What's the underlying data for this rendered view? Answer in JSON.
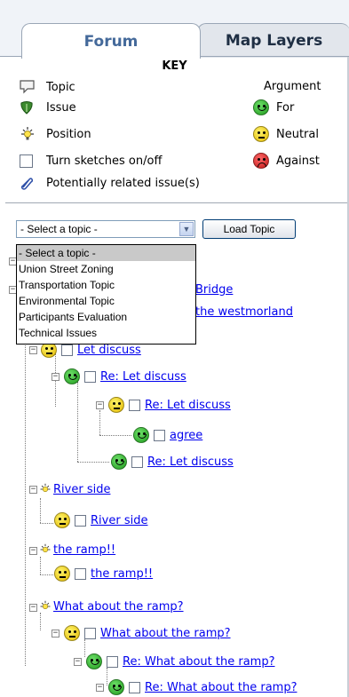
{
  "tabs": [
    {
      "label": "Forum",
      "active": true
    },
    {
      "label": "Map Layers",
      "active": false
    }
  ],
  "key": {
    "title": "KEY",
    "argument_title": "Argument",
    "items": [
      {
        "label": "Topic",
        "icon": "speech-bubble-icon"
      },
      {
        "label": "Issue",
        "icon": "issue-leaf-icon"
      },
      {
        "label": "Position",
        "icon": "lightbulb-icon"
      },
      {
        "label": "Turn sketches on/off",
        "icon": "checkbox"
      },
      {
        "label": "Potentially related issue(s)",
        "icon": "paperclip-icon"
      }
    ],
    "arguments": [
      {
        "label": "For",
        "icon": "green-smiley-icon",
        "color": "#2aa827"
      },
      {
        "label": "Neutral",
        "icon": "yellow-neutral-icon",
        "color": "#f2d000"
      },
      {
        "label": "Against",
        "icon": "red-frown-icon",
        "color": "#d21d1d"
      }
    ]
  },
  "topic_select": {
    "selected": "- Select a topic -",
    "options": [
      "- Select a topic -",
      "Union Street Zoning",
      "Transportation Topic",
      "Environmental Topic",
      "Participants Evaluation",
      "Technical Issues"
    ]
  },
  "load_button": "Load Topic",
  "tree": {
    "partial_1": "Bridge",
    "partial_2": "the westmorland",
    "nodes": [
      {
        "label": "Let discuss"
      },
      {
        "label": "Re: Let discuss"
      },
      {
        "label": "Re: Let discuss"
      },
      {
        "label": "agree"
      },
      {
        "label": "Re: Let discuss"
      },
      {
        "label": "River side"
      },
      {
        "label": "River side"
      },
      {
        "label": "the ramp!!"
      },
      {
        "label": "the ramp!!"
      },
      {
        "label": "What about the ramp?"
      },
      {
        "label": "What about the ramp?"
      },
      {
        "label": "Re: What about the ramp?"
      },
      {
        "label": "Re: What about the ramp?"
      }
    ]
  }
}
